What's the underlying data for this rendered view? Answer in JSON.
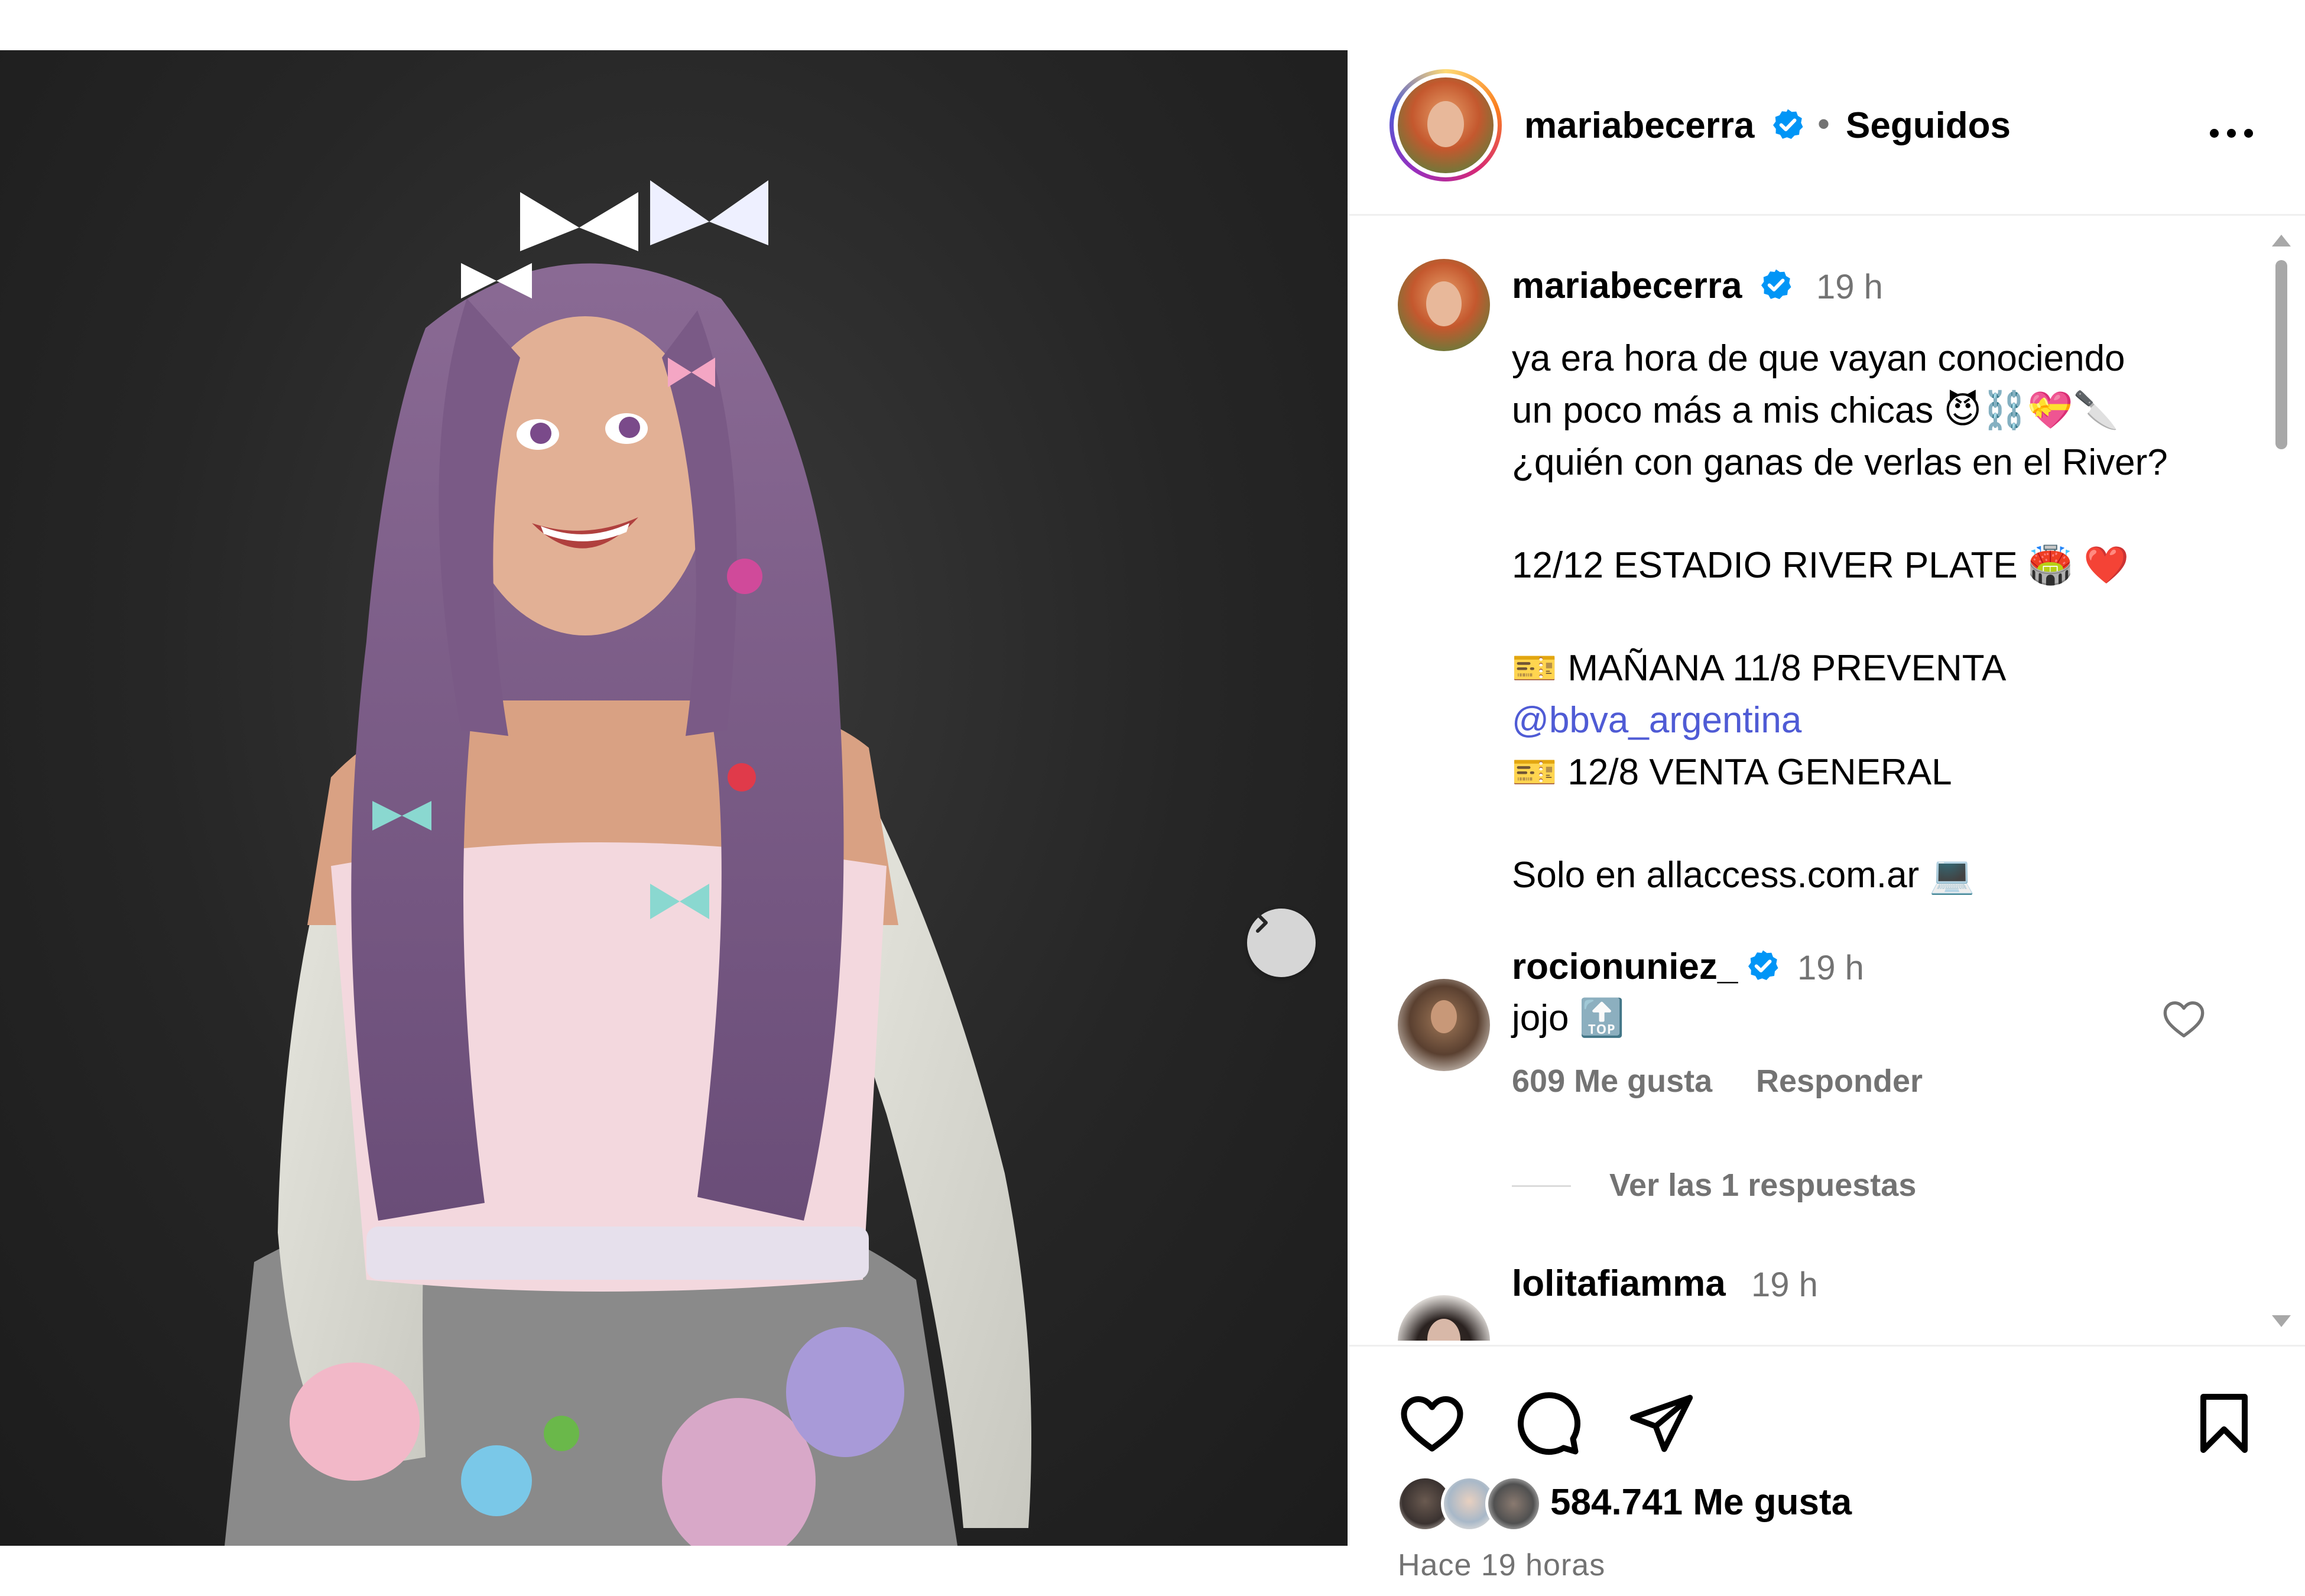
{
  "post": {
    "author": "mariabecerra",
    "follow_status": "Seguidos",
    "separator": "•"
  },
  "caption": {
    "author": "mariabecerra",
    "time": "19 h",
    "lines": [
      "ya era hora de que vayan conociendo",
      "un poco más a mis chicas 😈⛓️💝🔪",
      "¿quién con ganas de verlas en el River?",
      "12/12 ESTADIO RIVER PLATE 🏟️ ❤️",
      "🎫  MAÑANA 11/8 PREVENTA",
      "@bbva_argentina",
      "🎫  12/8 VENTA GENERAL",
      "Solo en allaccess.com.ar 💻"
    ]
  },
  "comments": [
    {
      "user": "rocionuniez_",
      "time": "19 h",
      "text": "jojo 🔝",
      "likes": "609 Me gusta",
      "reply": "Responder",
      "view_replies": "Ver las 1 respuestas"
    },
    {
      "user": "lolitafiamma",
      "time": "19 h"
    }
  ],
  "footer": {
    "likes": "584.741 Me gusta",
    "ago": "Hace 19 horas"
  },
  "icons": {
    "like": "heart-icon",
    "comment": "comment-icon",
    "share": "paper-plane-icon",
    "save": "bookmark-icon",
    "next": "chevron-right-icon",
    "verified": "verified-badge-icon",
    "more": "more-options-icon"
  },
  "colors": {
    "verified": "#0095f6",
    "mention": "#4f5bd5",
    "secondary_text": "#737373"
  }
}
